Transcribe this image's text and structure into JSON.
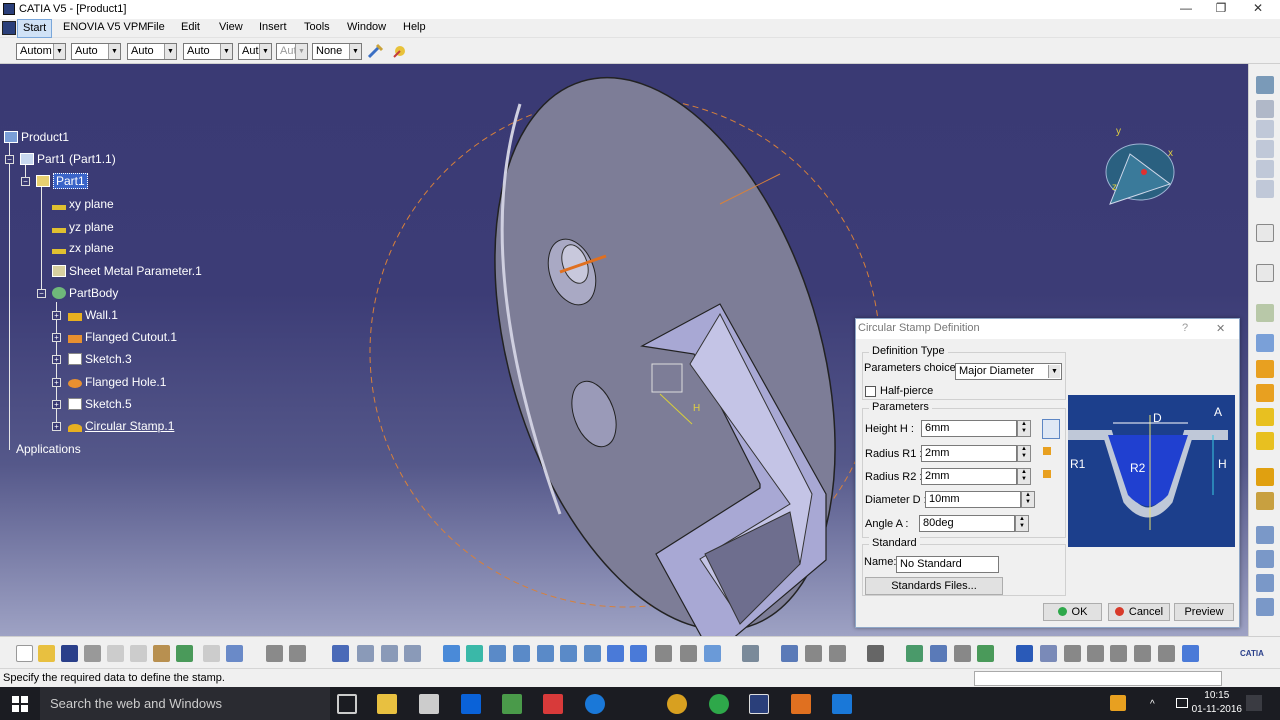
{
  "window": {
    "title": "CATIA V5 - [Product1]",
    "minimize": "—",
    "maximize": "❐",
    "close": "✕"
  },
  "menu": [
    "Start",
    "ENOVIA V5 VPM",
    "File",
    "Edit",
    "View",
    "Insert",
    "Tools",
    "Window",
    "Help"
  ],
  "toolbar_combos": [
    "Autom",
    "Auto",
    "Auto",
    "Auto",
    "Aut",
    "Aut",
    "None"
  ],
  "tree": {
    "product": "Product1",
    "part_instance": "Part1 (Part1.1)",
    "part": "Part1",
    "items": [
      "xy plane",
      "yz plane",
      "zx plane",
      "Sheet Metal Parameter.1",
      "PartBody"
    ],
    "body_items": [
      "Wall.1",
      "Flanged Cutout.1",
      "Sketch.3",
      "Flanged Hole.1",
      "Sketch.5",
      "Circular Stamp.1"
    ],
    "applications": "Applications"
  },
  "compass": {
    "x": "x",
    "y": "y",
    "z": "z"
  },
  "dialog": {
    "title": "Circular Stamp Definition",
    "help": "?",
    "close": "✕",
    "definition_type_label": "Definition Type",
    "parameters_choice_label": "Parameters choice :",
    "parameters_choice_value": "Major Diameter",
    "half_pierce_label": "Half-pierce",
    "parameters_label": "Parameters",
    "params": [
      {
        "label": "Height H  :",
        "value": "6mm"
      },
      {
        "label": "Radius R1 :",
        "value": "2mm"
      },
      {
        "label": "Radius R2 :",
        "value": "2mm"
      },
      {
        "label": "Diameter D :",
        "value": "10mm"
      },
      {
        "label": "Angle A   :",
        "value": "80deg"
      }
    ],
    "standard_label": "Standard",
    "name_label": "Name:",
    "name_value": "No Standard",
    "standards_files": "Standards Files...",
    "ok": "OK",
    "cancel": "Cancel",
    "preview": "Preview",
    "diagram_labels": {
      "D": "D",
      "A": "A",
      "R1": "R1",
      "R2": "R2",
      "H": "H"
    }
  },
  "viewport_label": "H",
  "status": {
    "message": "Specify the required data to define the stamp."
  },
  "taskbar": {
    "search": "Search the web and Windows",
    "time": "10:15",
    "date": "01-11-2016"
  },
  "catia_logo": "CATIA"
}
